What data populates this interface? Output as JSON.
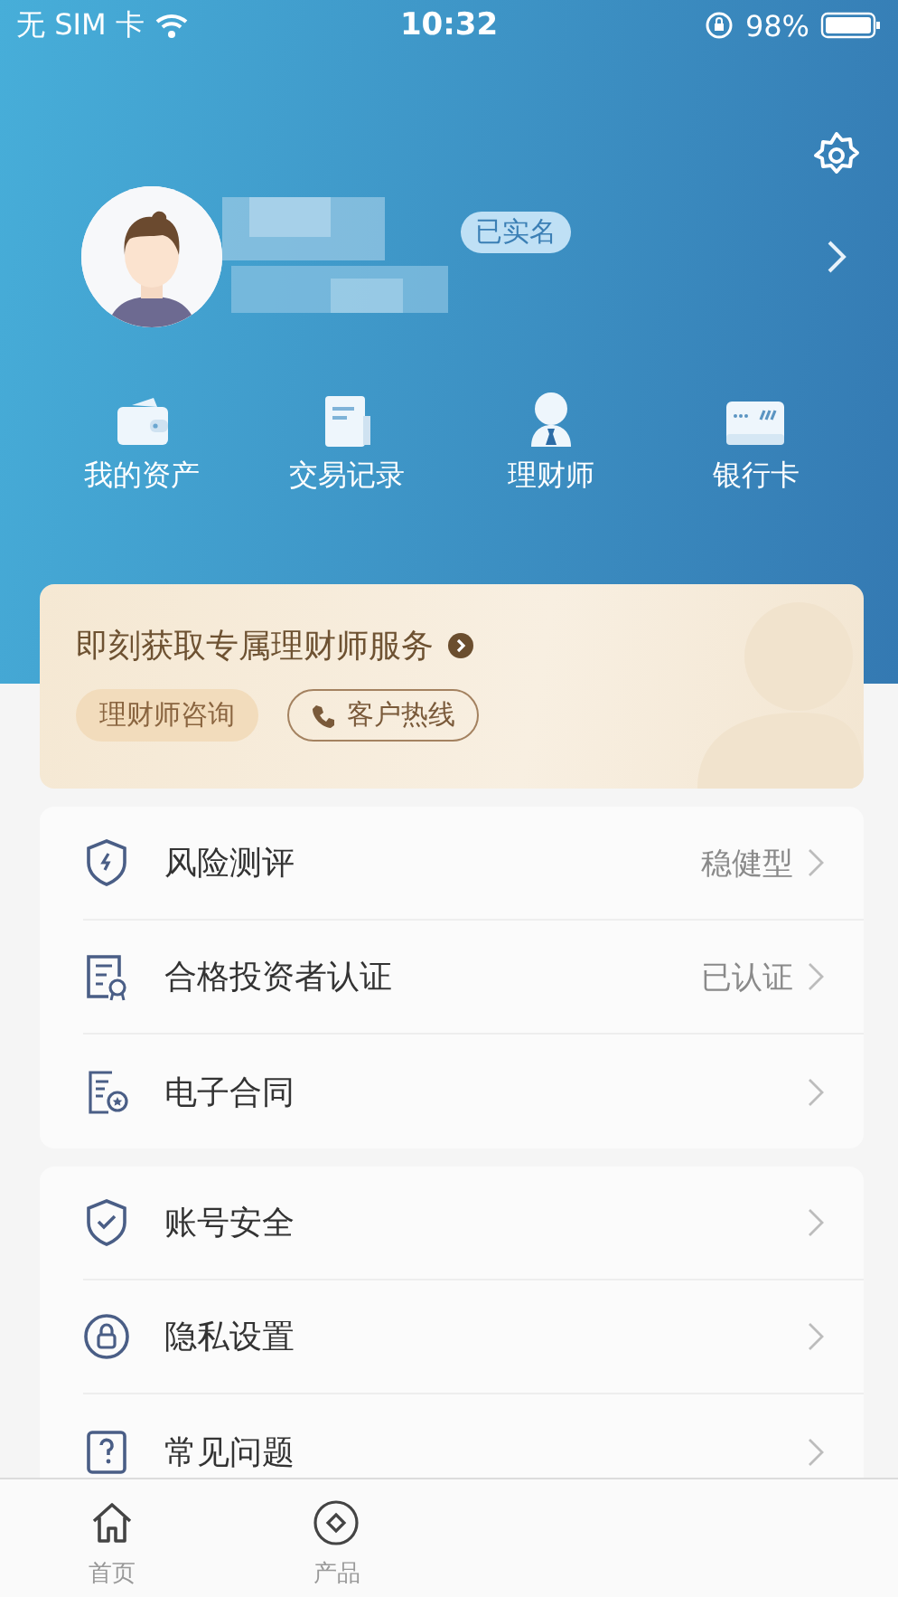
{
  "status_bar": {
    "carrier": "无 SIM 卡",
    "time": "10:32",
    "battery": "98%"
  },
  "header": {
    "verified_badge": "已实名",
    "actions": [
      {
        "label": "我的资产",
        "kind": "wallet"
      },
      {
        "label": "交易记录",
        "kind": "record"
      },
      {
        "label": "理财师",
        "kind": "advisor"
      },
      {
        "label": "银行卡",
        "kind": "card"
      }
    ]
  },
  "banner": {
    "title": "即刻获取专属理财师服务",
    "buttons": [
      {
        "label": "理财师咨询",
        "kind": "filled"
      },
      {
        "label": "客户热线",
        "kind": "outlined"
      }
    ]
  },
  "menu_groups": [
    {
      "items": [
        {
          "label": "风险测评",
          "value": "稳健型",
          "kind": "risk"
        },
        {
          "label": "合格投资者认证",
          "value": "已认证",
          "kind": "certificate"
        },
        {
          "label": "电子合同",
          "kind": "contract"
        }
      ]
    },
    {
      "items": [
        {
          "label": "账号安全",
          "kind": "security"
        },
        {
          "label": "隐私设置",
          "kind": "privacy"
        },
        {
          "label": "常见问题",
          "kind": "faq"
        }
      ]
    }
  ],
  "tab_bar": [
    {
      "label": "首页",
      "selected": false,
      "kind": "home"
    },
    {
      "label": "产品",
      "selected": false,
      "kind": "product"
    }
  ]
}
